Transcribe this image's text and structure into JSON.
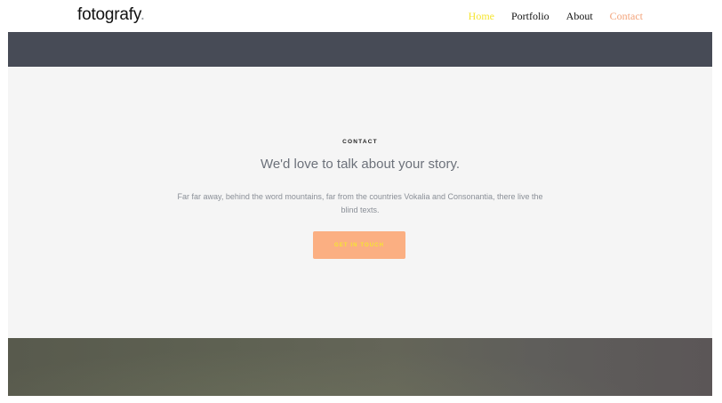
{
  "header": {
    "brand": {
      "name": "fotografy",
      "dot": "."
    },
    "nav": [
      {
        "label": "Home",
        "state": "active"
      },
      {
        "label": "Portfolio",
        "state": "default"
      },
      {
        "label": "About",
        "state": "default"
      },
      {
        "label": "Contact",
        "state": "highlight"
      }
    ]
  },
  "contact": {
    "kicker": "CONTACT",
    "heading": "We'd love to talk about your story.",
    "description": "Far far away, behind the word mountains, far from the countries Vokalia and Consonantia, there live the blind texts.",
    "cta_label": "GET IN TOUCH"
  },
  "colors": {
    "accent_yellow": "#f5e531",
    "accent_peach": "#fbaf82",
    "dark_band": "#474b56",
    "section_bg": "#f5f5f5"
  }
}
